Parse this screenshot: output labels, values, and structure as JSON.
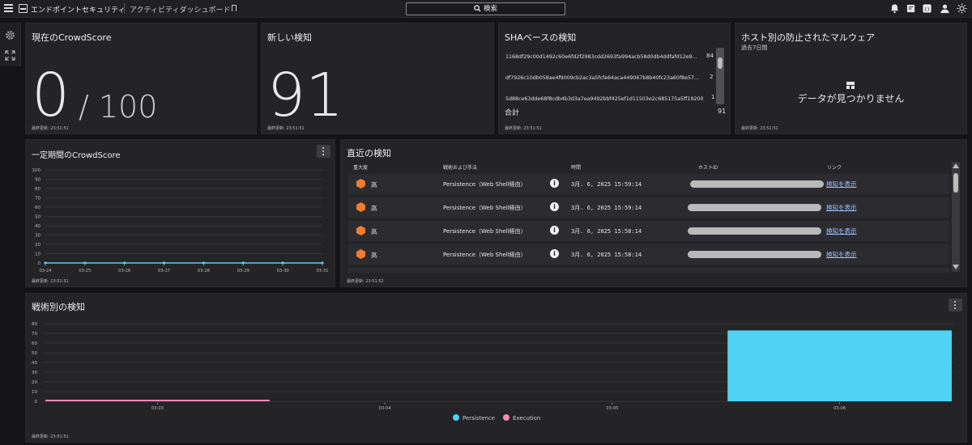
{
  "header": {
    "app_title": "エンドポイントセキュリティ",
    "page_title": "アクティビティダッシュボード",
    "search_label": "検索"
  },
  "cards": {
    "current_score": {
      "title": "現在のCrowdScore",
      "value": "0",
      "max": "/ 100",
      "updated": "最終更新: 23:51:51"
    },
    "new_detections": {
      "title": "新しい検知",
      "value": "91",
      "updated": "最終更新: 23:51:51"
    },
    "sha": {
      "title": "SHAベースの検知",
      "rows": [
        {
          "hash": "1168df29c00d1492c60e6fd2f2983cdd2693fa994acb58d0db4ddfafd12e9...",
          "count": "84"
        },
        {
          "hash": "df7926c10db058ae4f9009cb2ac3a5fcfe64aca449067b8b40fc23a60f8e57...",
          "count": "2"
        },
        {
          "hash": "5d88ce63dde68f8cdb4b3d3a7ea9492bbf425ef1d11503e2c685175a5ff19200",
          "count": "1"
        }
      ],
      "total_label": "合計",
      "total": "91",
      "updated": "最終更新: 23:51:51"
    },
    "malware": {
      "title": "ホスト別の防止されたマルウェア",
      "subtitle": "過去7日間",
      "empty": "データが見つかりません",
      "updated": "最終更新: 23:51:51"
    },
    "score_trend": {
      "title": "一定期間のCrowdScore",
      "updated": "最終更新: 23:51:51"
    },
    "recent": {
      "title": "直近の検知",
      "headers": {
        "severity": "重大度",
        "tactic": "戦術および手法",
        "time": "時間",
        "host": "ホストID",
        "link": "リンク"
      },
      "rows": [
        {
          "severity": "高",
          "tactic": "Persistence（Web Shell経由）",
          "time": "3月. 6, 2025 15:59:14",
          "link": "検知を表示"
        },
        {
          "severity": "高",
          "tactic": "Persistence（Web Shell経由）",
          "time": "3月. 6, 2025 15:59:14",
          "link": "検知を表示"
        },
        {
          "severity": "高",
          "tactic": "Persistence（Web Shell経由）",
          "time": "3月. 6, 2025 15:58:14",
          "link": "検知を表示"
        },
        {
          "severity": "高",
          "tactic": "Persistence（Web Shell経由）",
          "time": "3月. 6, 2025 15:58:14",
          "link": "検知を表示"
        }
      ],
      "updated": "最終更新: 23:51:52"
    },
    "tactics": {
      "title": "戦術別の検知",
      "updated": "最終更新: 23:51:51"
    }
  },
  "colors": {
    "persistence": "#4fd3f3",
    "execution": "#f18ab2",
    "severity_high": "#f07c31",
    "link": "#9fc2ff"
  },
  "chart_data": [
    {
      "type": "line",
      "x": [
        "03-24",
        "03-25",
        "03-26",
        "03-27",
        "03-28",
        "03-29",
        "03-30",
        "03-31"
      ],
      "series": [
        {
          "values": [
            0,
            0,
            0,
            0,
            0,
            0,
            0,
            0
          ]
        }
      ],
      "ylim": [
        0,
        100
      ],
      "yticks": [
        0,
        10,
        20,
        30,
        40,
        50,
        60,
        70,
        80,
        90,
        100
      ],
      "grid": true
    },
    {
      "type": "bar",
      "categories": [
        "03-03",
        "03-04",
        "03-05",
        "03-06"
      ],
      "series": [
        {
          "name": "Persistence",
          "values": [
            0,
            0,
            0,
            73
          ]
        },
        {
          "name": "Execution",
          "values": [
            1,
            0,
            0,
            0
          ]
        }
      ],
      "ylim": [
        0,
        80
      ],
      "yticks": [
        0,
        10,
        20,
        30,
        40,
        50,
        60,
        70,
        80
      ],
      "grid": true,
      "legend": "bottom"
    }
  ]
}
